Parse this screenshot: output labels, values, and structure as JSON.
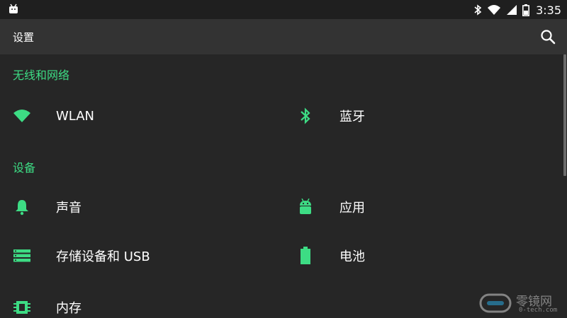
{
  "status_bar": {
    "time": "3:35",
    "icons": [
      "android-debug-icon",
      "bluetooth-icon",
      "wifi-icon",
      "signal-icon",
      "battery-icon"
    ]
  },
  "toolbar": {
    "title": "设置",
    "search_icon": "search-icon"
  },
  "sections": [
    {
      "header": "无线和网络",
      "items": [
        {
          "label": "WLAN",
          "icon": "wifi-icon"
        },
        {
          "label": "蓝牙",
          "icon": "bluetooth-icon"
        }
      ]
    },
    {
      "header": "设备",
      "items": [
        {
          "label": "声音",
          "icon": "bell-icon"
        },
        {
          "label": "应用",
          "icon": "android-icon"
        },
        {
          "label": "存储设备和 USB",
          "icon": "storage-icon"
        },
        {
          "label": "电池",
          "icon": "battery-icon"
        },
        {
          "label": "内存",
          "icon": "memory-icon"
        }
      ]
    }
  ],
  "watermark": {
    "text": "零镜网",
    "sub": "0-tech.com"
  },
  "colors": {
    "accent": "#3ddc84",
    "background": "#262626",
    "toolbar": "#333333",
    "statusbar": "#1f1f1f"
  }
}
